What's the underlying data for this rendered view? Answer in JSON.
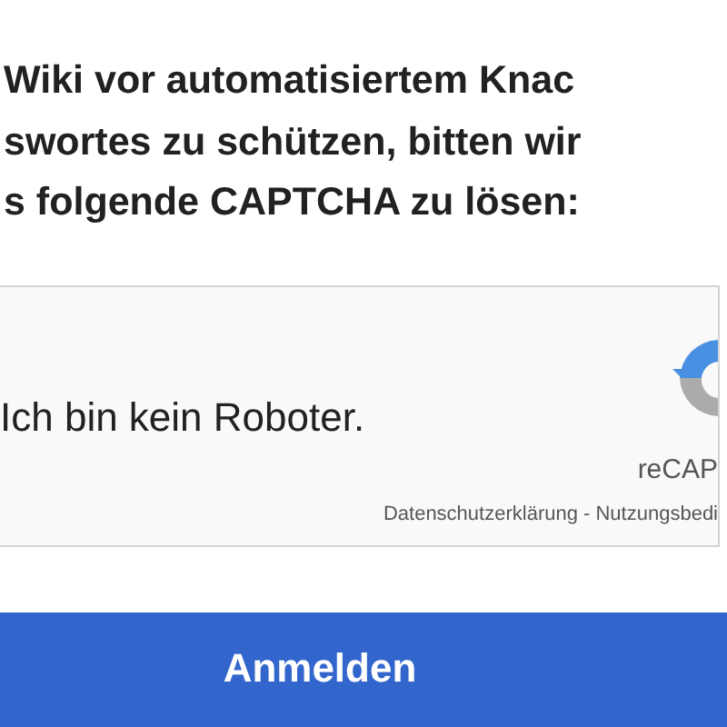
{
  "instruction_lines": [
    "Wiki vor automatisiertem Knac",
    "swortes zu schützen, bitten wir",
    "s folgende CAPTCHA zu lösen:"
  ],
  "captcha": {
    "label": "Ich bin kein Roboter.",
    "brand": "reCAP",
    "links": "Datenschutzerklärung - Nutzungsbedi"
  },
  "submit_button": "Anmelden"
}
